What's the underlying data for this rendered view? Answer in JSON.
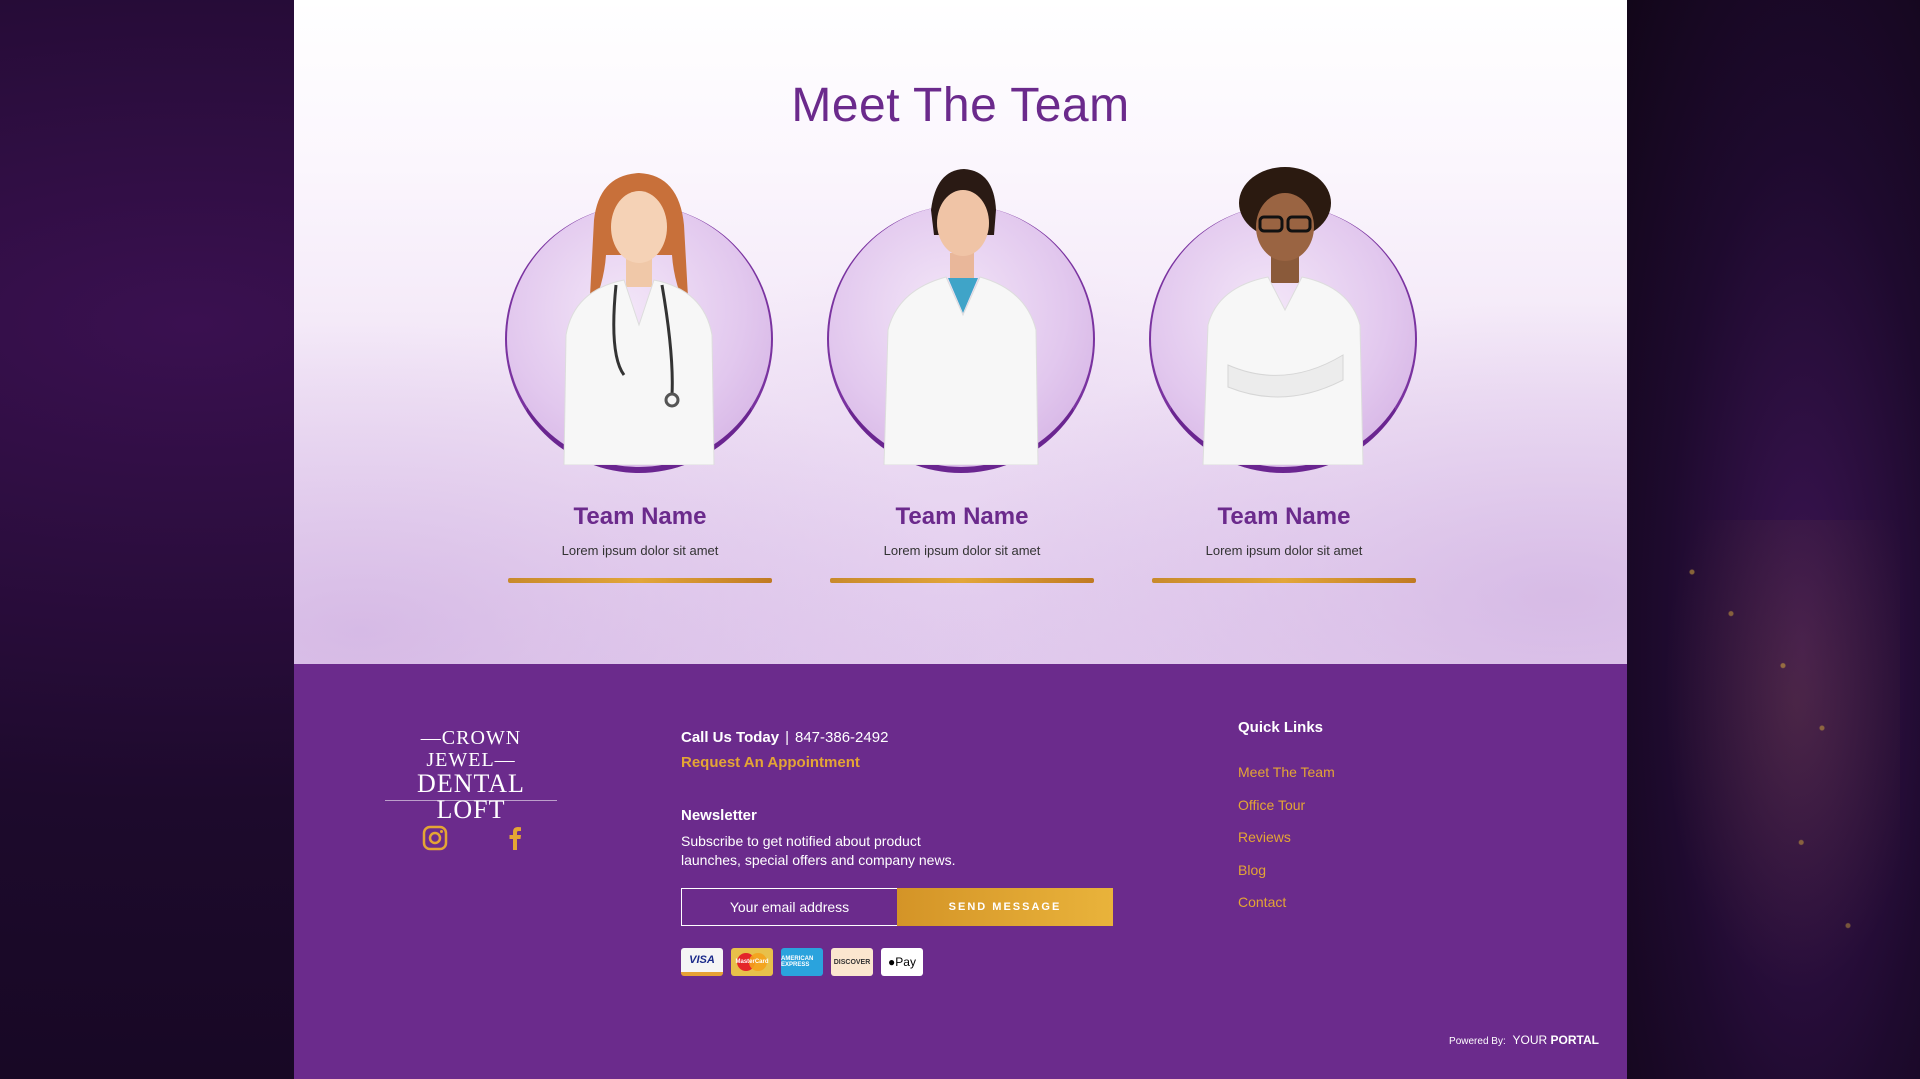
{
  "team": {
    "title": "Meet The Team",
    "members": [
      {
        "name": "Team Name",
        "desc": "Lorem ipsum dolor sit amet"
      },
      {
        "name": "Team Name",
        "desc": "Lorem ipsum dolor sit amet"
      },
      {
        "name": "Team Name",
        "desc": "Lorem ipsum dolor sit amet"
      }
    ]
  },
  "footer": {
    "logo": {
      "line1": "—CROWN JEWEL—",
      "line2": "DENTAL LOFT"
    },
    "social": [
      "instagram-icon",
      "facebook-icon"
    ],
    "call_label": "Call Us Today",
    "separator": "|",
    "phone": "847-386-2492",
    "request_link": "Request An Appointment",
    "newsletter_title": "Newsletter",
    "newsletter_text": "Subscribe to get notified about product launches, special offers and company news.",
    "email_placeholder": "Your email address",
    "send_label": "SEND MESSAGE",
    "payments": [
      "VISA",
      "MasterCard",
      "AMERICAN EXPRESS",
      "DISCOVER",
      "Pay"
    ],
    "quick_links_title": "Quick Links",
    "quick_links": [
      "Meet The Team",
      "Office Tour",
      "Reviews",
      "Blog",
      "Contact"
    ],
    "powered_label": "Powered By:",
    "powered_brand_a": "YOUR",
    "powered_brand_b": "PORTAL"
  },
  "colors": {
    "brand_purple": "#6b2b8c",
    "accent_gold": "#e4a534"
  }
}
